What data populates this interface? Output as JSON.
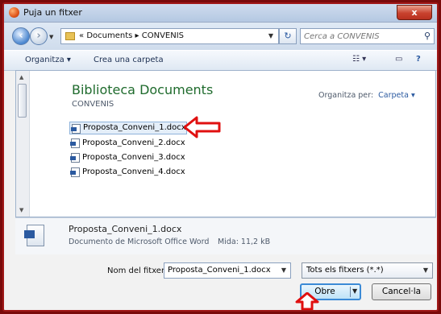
{
  "window": {
    "title": "Puja un fitxer",
    "close_label": "x"
  },
  "nav": {
    "breadcrumb": [
      "«",
      "Documents",
      "▸",
      "CONVENIS"
    ],
    "search_placeholder": "Cerca a CONVENIS"
  },
  "commands": {
    "organize": "Organitza ▾",
    "new_folder": "Crea una carpeta"
  },
  "library": {
    "title": "Biblioteca Documents",
    "subtitle": "CONVENIS",
    "arrange_label": "Organitza per:",
    "arrange_value": "Carpeta ▾"
  },
  "files": [
    "Proposta_Conveni_1.docx",
    "Proposta_Conveni_2.docx",
    "Proposta_Conveni_3.docx",
    "Proposta_Conveni_4.docx"
  ],
  "details": {
    "name": "Proposta_Conveni_1.docx",
    "type": "Documento de Microsoft Office Word",
    "size": "Mida: 11,2 kB"
  },
  "footer": {
    "filename_label": "Nom del fitxer:",
    "filename_value": "Proposta_Conveni_1.docx",
    "filter_value": "Tots els fitxers (*.*)",
    "open_label": "Obre",
    "cancel_label": "Cancel·la"
  },
  "icons": {
    "app": "firefox-icon",
    "back": "back-arrow-icon",
    "forward": "forward-arrow-icon",
    "folder": "folder-icon",
    "refresh": "refresh-icon",
    "search": "search-icon",
    "views": "views-icon",
    "preview": "preview-pane-icon",
    "help": "help-icon",
    "file": "word-document-icon",
    "annotation": "red-arrow-icon"
  },
  "colors": {
    "annotation_arrow": "#e01010",
    "library_title": "#1f6b2d",
    "border": "#a01818"
  }
}
